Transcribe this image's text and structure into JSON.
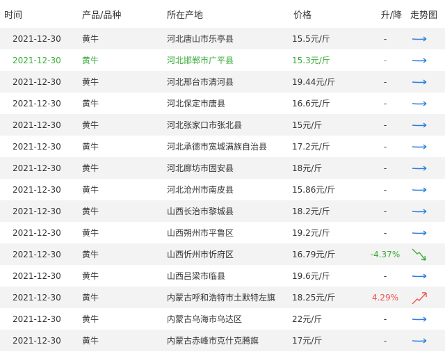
{
  "header": {
    "date": "时间",
    "product": "产品/品种",
    "location": "所在产地",
    "price": "价格",
    "change": "升/降",
    "trend": "走势图"
  },
  "colors": {
    "flat_arrow": "#2a7de1",
    "down_arrow": "#3bab3b",
    "up_arrow": "#f05050",
    "highlight_text": "#3bab3b",
    "stripe": "#f3f3f3"
  },
  "rows": [
    {
      "date": "2021-12-30",
      "product": "黄牛",
      "location": "河北唐山市乐亭县",
      "price": "15.5元/斤",
      "change": "-",
      "trend": "flat"
    },
    {
      "date": "2021-12-30",
      "product": "黄牛",
      "location": "河北邯郸市广平县",
      "price": "15.3元/斤",
      "change": "-",
      "trend": "flat"
    },
    {
      "date": "2021-12-30",
      "product": "黄牛",
      "location": "河北邢台市清河县",
      "price": "19.44元/斤",
      "change": "-",
      "trend": "flat"
    },
    {
      "date": "2021-12-30",
      "product": "黄牛",
      "location": "河北保定市唐县",
      "price": "16.6元/斤",
      "change": "-",
      "trend": "flat"
    },
    {
      "date": "2021-12-30",
      "product": "黄牛",
      "location": "河北张家口市张北县",
      "price": "15元/斤",
      "change": "-",
      "trend": "flat"
    },
    {
      "date": "2021-12-30",
      "product": "黄牛",
      "location": "河北承德市宽城满族自治县",
      "price": "17.2元/斤",
      "change": "-",
      "trend": "flat"
    },
    {
      "date": "2021-12-30",
      "product": "黄牛",
      "location": "河北廊坊市固安县",
      "price": "18元/斤",
      "change": "-",
      "trend": "flat"
    },
    {
      "date": "2021-12-30",
      "product": "黄牛",
      "location": "河北沧州市南皮县",
      "price": "15.86元/斤",
      "change": "-",
      "trend": "flat"
    },
    {
      "date": "2021-12-30",
      "product": "黄牛",
      "location": "山西长治市黎城县",
      "price": "18.2元/斤",
      "change": "-",
      "trend": "flat"
    },
    {
      "date": "2021-12-30",
      "product": "黄牛",
      "location": "山西朔州市平鲁区",
      "price": "19.2元/斤",
      "change": "-",
      "trend": "flat"
    },
    {
      "date": "2021-12-30",
      "product": "黄牛",
      "location": "山西忻州市忻府区",
      "price": "16.79元/斤",
      "change": "-4.37%",
      "trend": "down"
    },
    {
      "date": "2021-12-30",
      "product": "黄牛",
      "location": "山西吕梁市临县",
      "price": "19.6元/斤",
      "change": "-",
      "trend": "flat"
    },
    {
      "date": "2021-12-30",
      "product": "黄牛",
      "location": "内蒙古呼和浩特市土默特左旗",
      "price": "18.25元/斤",
      "change": "4.29%",
      "trend": "up"
    },
    {
      "date": "2021-12-30",
      "product": "黄牛",
      "location": "内蒙古乌海市乌达区",
      "price": "22元/斤",
      "change": "-",
      "trend": "flat"
    },
    {
      "date": "2021-12-30",
      "product": "黄牛",
      "location": "内蒙古赤峰市克什克腾旗",
      "price": "17元/斤",
      "change": "-",
      "trend": "flat"
    }
  ]
}
